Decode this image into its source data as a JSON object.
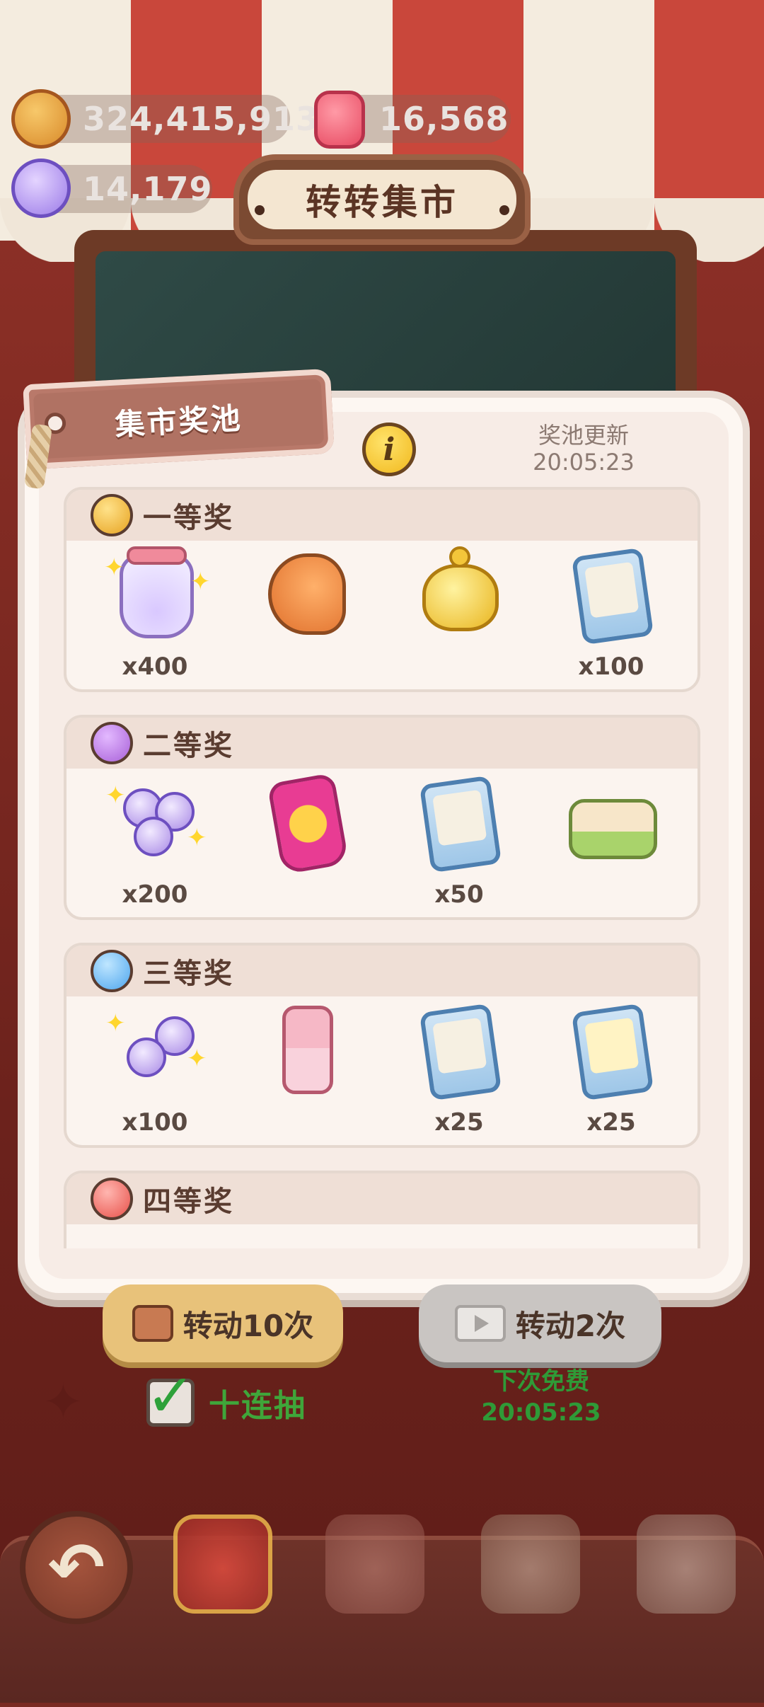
{
  "currency": {
    "coins": "324,415,913",
    "gems": "16,568",
    "candies": "14,179"
  },
  "header": {
    "title": "转转集市"
  },
  "panel": {
    "tab_label": "集市奖池",
    "refresh_label": "奖池更新",
    "refresh_time": "20:05:23"
  },
  "prizes": [
    {
      "title": "一等奖",
      "orb_color": "#e7a321",
      "items": [
        {
          "icon": "candy-jar",
          "qty": "x400"
        },
        {
          "icon": "rocking-horse",
          "qty": ""
        },
        {
          "icon": "golden-teapot",
          "qty": ""
        },
        {
          "icon": "skill-card-axe",
          "qty": "x100"
        }
      ]
    },
    {
      "title": "二等奖",
      "orb_color": "#a860d8",
      "items": [
        {
          "icon": "candy-bundle",
          "qty": "x200"
        },
        {
          "icon": "sunflower-seed-bag",
          "qty": ""
        },
        {
          "icon": "skill-card-axe",
          "qty": "x50"
        },
        {
          "icon": "bunny-sofa",
          "qty": ""
        }
      ]
    },
    {
      "title": "三等奖",
      "orb_color": "#4ea6ee",
      "items": [
        {
          "icon": "candy-pair",
          "qty": "x100"
        },
        {
          "icon": "clover-phone",
          "qty": ""
        },
        {
          "icon": "skill-card-book",
          "qty": "x25"
        },
        {
          "icon": "skill-card-fist",
          "qty": "x25"
        }
      ]
    },
    {
      "title": "四等奖",
      "orb_color": "#e8514a",
      "items": []
    }
  ],
  "actions": {
    "spin10_label": "转动10次",
    "spin2_label": "转动2次",
    "ten_draw_label": "十连抽",
    "ten_draw_checked": true,
    "free_label": "下次免费",
    "free_time": "20:05:23"
  },
  "nav": {
    "tabs": [
      "back",
      "market",
      "doll-shop",
      "house",
      "furniture"
    ]
  }
}
